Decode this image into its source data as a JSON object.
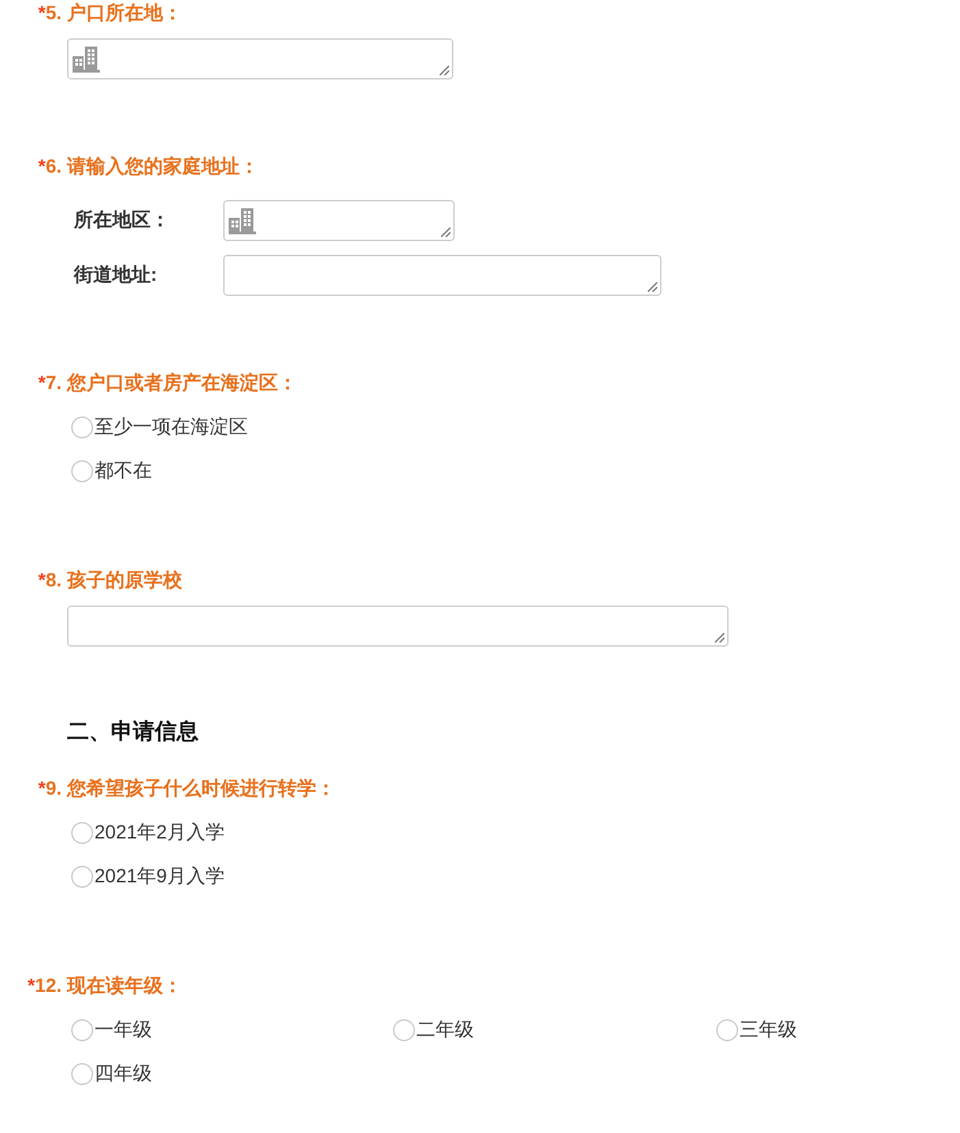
{
  "form": {
    "items": [
      {
        "kind": "region",
        "mark": "*",
        "number": "5.",
        "title": "户口所在地："
      },
      {
        "kind": "address",
        "mark": "*",
        "number": "6.",
        "title": "请输入您的家庭地址：",
        "fields": [
          {
            "kind": "region",
            "label": "所在地区："
          },
          {
            "kind": "text",
            "label": "街道地址:"
          }
        ]
      },
      {
        "kind": "choice",
        "mark": "*",
        "number": "7.",
        "title": "您户口或者房产在海淀区：",
        "options": [
          {
            "label": "至少一项在海淀区",
            "selected": false
          },
          {
            "label": "都不在",
            "selected": false
          }
        ]
      },
      {
        "kind": "text",
        "mark": "*",
        "number": "8.",
        "title": "孩子的原学校"
      },
      {
        "kind": "section",
        "title": "二、申请信息"
      },
      {
        "kind": "choice",
        "mark": "*",
        "number": "9.",
        "title": "您希望孩子什么时候进行转学：",
        "options": [
          {
            "label": "2021年2月入学",
            "selected": false
          },
          {
            "label": "2021年9月入学",
            "selected": false
          }
        ]
      },
      {
        "kind": "choice_grid",
        "mark": "*",
        "number": "12.",
        "title": "现在读年级：",
        "options": [
          {
            "label": "一年级",
            "selected": false
          },
          {
            "label": "二年级",
            "selected": false
          },
          {
            "label": "三年级",
            "selected": false
          },
          {
            "label": "四年级",
            "selected": false
          }
        ]
      }
    ]
  }
}
